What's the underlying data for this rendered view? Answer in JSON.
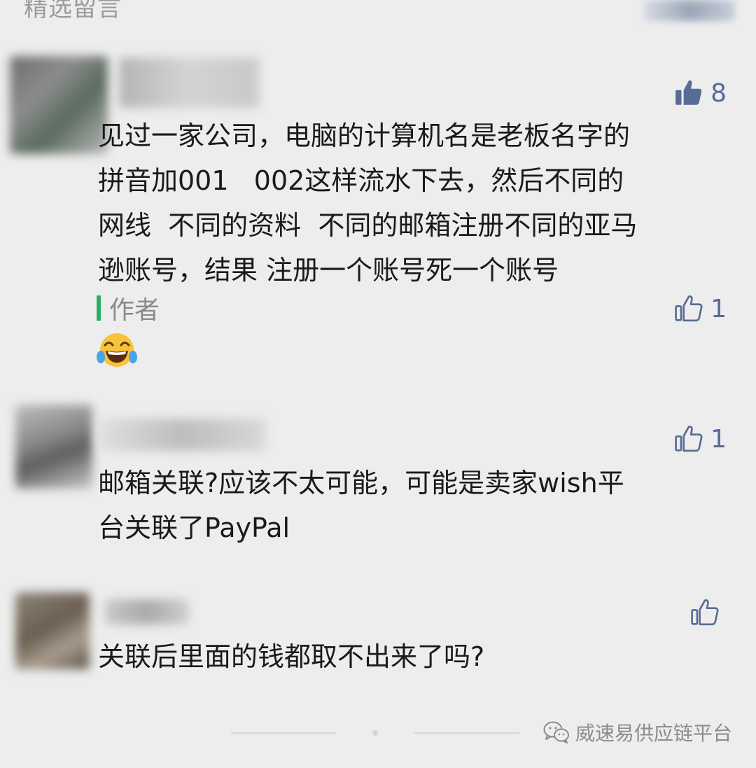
{
  "section_title": "精选留言",
  "comments": [
    {
      "likes": "8",
      "liked": true,
      "text": "见过一家公司，电脑的计算机名是老板名字的\n拼音加001   002这样流水下去，然后不同的\n网线  不同的资料  不同的邮箱注册不同的亚马\n逊账号，结果 注册一个账号死一个账号",
      "reply": {
        "author": "作者",
        "likes": "1",
        "emoji": "face-with-tears-of-joy"
      }
    },
    {
      "likes": "1",
      "liked": false,
      "text": "邮箱关联?应该不太可能，可能是卖家wish平\n台关联了PayPal"
    },
    {
      "likes": "",
      "liked": false,
      "text": "关联后里面的钱都取不出来了吗?"
    }
  ],
  "watermark": {
    "icon": "wechat-icon",
    "text": "威速易供应链平台"
  },
  "colors": {
    "background": "#ededed",
    "like_accent": "#576b95",
    "author_bar": "#2aae67"
  }
}
